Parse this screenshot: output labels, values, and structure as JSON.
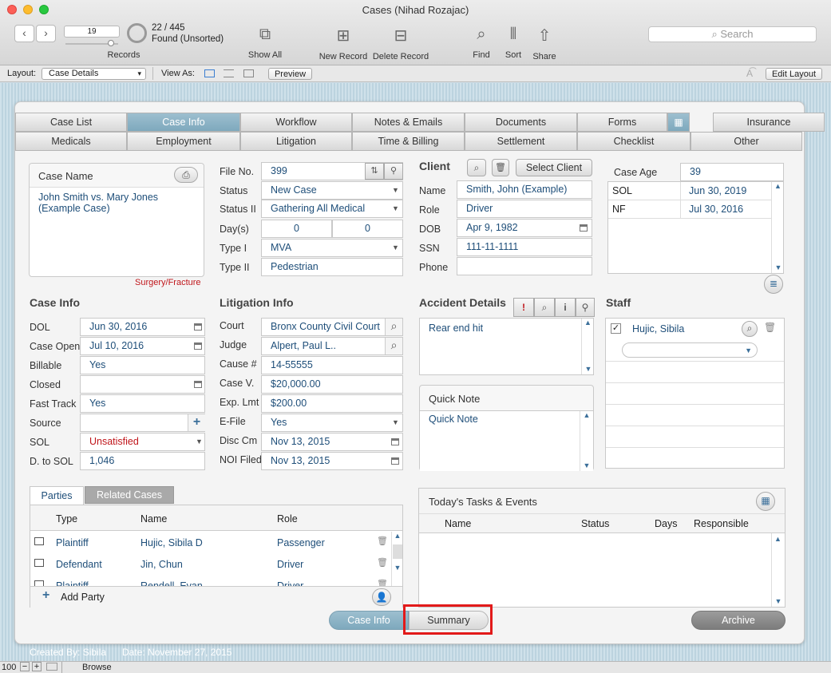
{
  "window": {
    "title": "Cases (Nihad Rozajac)"
  },
  "toolbar": {
    "record_number": "19",
    "records_label": "Records",
    "found_count": "22 / 445",
    "found_status": "Found (Unsorted)",
    "show_all": "Show All",
    "new_record": "New Record",
    "delete_record": "Delete Record",
    "find": "Find",
    "sort": "Sort",
    "share": "Share",
    "search_placeholder": "Search"
  },
  "layoutbar": {
    "layout_label": "Layout:",
    "layout_value": "Case Details",
    "view_as": "View As:",
    "preview": "Preview",
    "edit_layout": "Edit Layout"
  },
  "tabs_row1": [
    "Case List",
    "Case Info",
    "Workflow",
    "Notes & Emails",
    "Documents",
    "Forms",
    "Insurance"
  ],
  "tabs_row2": [
    "Medicals",
    "Employment",
    "Litigation",
    "Time & Billing",
    "Settlement",
    "Checklist",
    "Other"
  ],
  "casename": {
    "title": "Case Name",
    "value": "John Smith vs. Mary Jones (Example Case)",
    "tag": "Surgery/Fracture"
  },
  "fileinfo": {
    "file_no_label": "File No.",
    "file_no": "399",
    "status_label": "Status",
    "status": "New Case",
    "status2_label": "Status II",
    "status2": "Gathering All Medical",
    "days_label": "Day(s)",
    "days1": "0",
    "days2": "0",
    "type1_label": "Type I",
    "type1": "MVA",
    "type2_label": "Type II",
    "type2": "Pedestrian"
  },
  "client": {
    "title": "Client",
    "select_btn": "Select Client",
    "name_label": "Name",
    "name": "Smith, John (Example)",
    "role_label": "Role",
    "role": "Driver",
    "dob_label": "DOB",
    "dob": "Apr 9, 1982",
    "ssn_label": "SSN",
    "ssn": "111-11-1111",
    "phone_label": "Phone",
    "phone": ""
  },
  "caseage": {
    "label": "Case Age",
    "value": "39",
    "rows": [
      {
        "name": "SOL",
        "date": "Jun 30, 2019"
      },
      {
        "name": "NF",
        "date": "Jul 30, 2016"
      }
    ]
  },
  "caseinfo": {
    "title": "Case Info",
    "dol_label": "DOL",
    "dol": "Jun 30, 2016",
    "open_label": "Case Open",
    "open": "Jul 10, 2016",
    "billable_label": "Billable",
    "billable": "Yes",
    "closed_label": "Closed",
    "closed": "",
    "fasttrack_label": "Fast Track",
    "fasttrack": "Yes",
    "source_label": "Source",
    "source": "",
    "sol_label": "SOL",
    "sol": "Unsatisfied",
    "dsol_label": "D. to SOL",
    "dsol": "1,046"
  },
  "litigation": {
    "title": "Litigation Info",
    "court_label": "Court",
    "court": "Bronx County Civil Court",
    "judge_label": "Judge",
    "judge": "Alpert, Paul L..",
    "cause_label": "Cause #",
    "cause": "14-55555",
    "casev_label": "Case V.",
    "casev": "$20,000.00",
    "explmt_label": "Exp. Lmt",
    "explmt": "$200.00",
    "efile_label": "E-File",
    "efile": "Yes",
    "disc_label": "Disc Cm",
    "disc": "Nov 13, 2015",
    "noi_label": "NOI Filed",
    "noi": "Nov 13, 2015"
  },
  "accident": {
    "title": "Accident Details",
    "text": "Rear end hit"
  },
  "quicknote": {
    "title": "Quick Note",
    "text": "Quick Note"
  },
  "staff": {
    "title": "Staff",
    "member": "Hujic, Sibila"
  },
  "parties": {
    "tab1": "Parties",
    "tab2": "Related Cases",
    "headers": [
      "Type",
      "Name",
      "Role"
    ],
    "rows": [
      {
        "type": "Plaintiff",
        "name": "Hujic, Sibila D",
        "role": "Passenger"
      },
      {
        "type": "Defendant",
        "name": "Jin, Chun",
        "role": "Driver"
      },
      {
        "type": "Plaintiff",
        "name": "Rendell, Evan",
        "role": "Driver"
      }
    ],
    "add": "Add Party"
  },
  "tasks": {
    "title": "Today's Tasks & Events",
    "headers": [
      "Name",
      "Status",
      "Days",
      "Responsible"
    ]
  },
  "bottom": {
    "caseinfo_btn": "Case Info",
    "summary_btn": "Summary",
    "archive_btn": "Archive",
    "created": "Created By: Sibila",
    "date": "Date: November 27, 2015"
  },
  "statusbar": {
    "zoom": "100",
    "mode": "Browse"
  }
}
